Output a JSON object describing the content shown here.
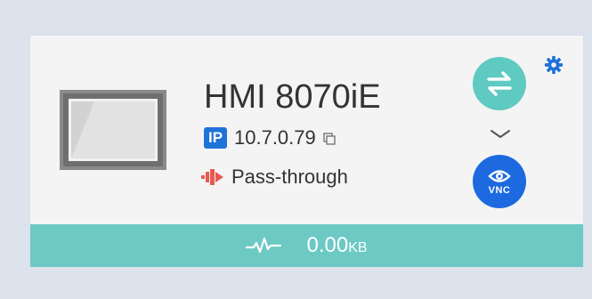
{
  "device": {
    "name": "HMI 8070iE",
    "ip_badge": "IP",
    "ip": "10.7.0.79",
    "mode": "Pass-through"
  },
  "actions": {
    "vnc_label": "VNC"
  },
  "traffic": {
    "value": "0.00",
    "unit": "KB"
  },
  "colors": {
    "teal": "#5fcac1",
    "footer": "#6cc9c4",
    "blue": "#1d6ae0",
    "ip_badge": "#1f72d8",
    "passthrough_red": "#e85a4f"
  },
  "icons": [
    "device-screen-icon",
    "copy-icon",
    "pass-through-icon",
    "sync-arrows-icon",
    "gear-icon",
    "chevron-down-icon",
    "eye-icon",
    "activity-pulse-icon"
  ]
}
